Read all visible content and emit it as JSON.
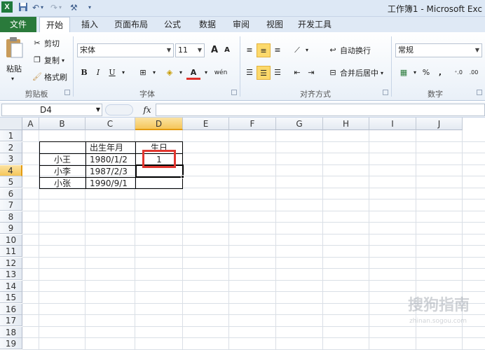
{
  "titlebar": {
    "title": "工作簿1 - Microsoft Exc",
    "logo": "X",
    "save_icon": "save-icon",
    "undo_icon": "undo-icon",
    "redo_icon": "redo-icon",
    "custom_icon": "customize-icon"
  },
  "tabs": {
    "file": "文件",
    "items": [
      "开始",
      "插入",
      "页面布局",
      "公式",
      "数据",
      "审阅",
      "视图",
      "开发工具"
    ],
    "active": "开始"
  },
  "ribbon": {
    "clipboard": {
      "paste": "粘贴",
      "cut": "剪切",
      "copy": "复制",
      "format_painter": "格式刷",
      "label": "剪贴板"
    },
    "font": {
      "name": "宋体",
      "size": "11",
      "bold": "B",
      "italic": "I",
      "underline": "U",
      "grow": "A",
      "shrink": "A",
      "color_letter": "A",
      "wen": "wén",
      "label": "字体"
    },
    "alignment": {
      "wrap_text": "自动换行",
      "merge_center": "合并后居中",
      "label": "对齐方式"
    },
    "number": {
      "format": "常规",
      "percent": "%",
      "comma": ",",
      "label": "数字"
    }
  },
  "formula_bar": {
    "name_box": "D4",
    "fx": "fx",
    "value": ""
  },
  "sheet": {
    "columns": [
      "A",
      "B",
      "C",
      "D",
      "E",
      "F",
      "G",
      "H",
      "I",
      "J"
    ],
    "rows": [
      "1",
      "2",
      "3",
      "4",
      "5",
      "6",
      "7",
      "8",
      "9",
      "10",
      "11",
      "12",
      "13",
      "14",
      "15",
      "16",
      "17",
      "18",
      "19"
    ],
    "selected_column": "D",
    "selected_row": "4",
    "cells": {
      "C2": "出生年月",
      "D2": "生日",
      "B3": "小王",
      "C3": "1980/1/2",
      "D3": "1",
      "B4": "小李",
      "C4": "1987/2/3",
      "B5": "小张",
      "C5": "1990/9/1"
    }
  },
  "watermark": {
    "text": "搜狗指南",
    "sub": "zhinan.sogou.com"
  }
}
